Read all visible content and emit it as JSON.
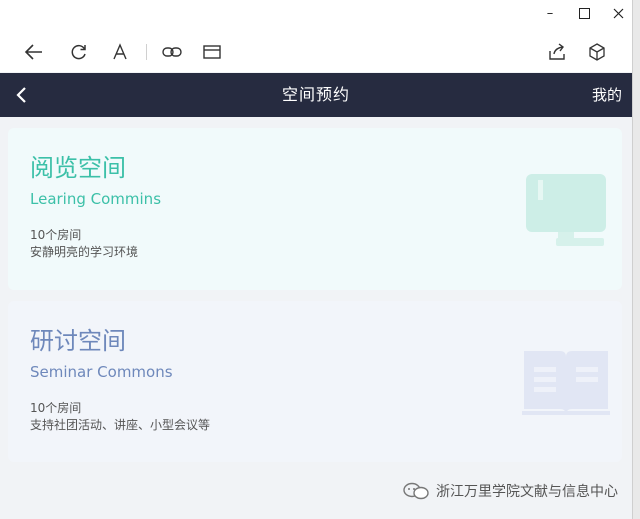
{
  "window": {
    "minimize": "–",
    "maximize": "☐",
    "close": "✕"
  },
  "toolbar": {
    "icons": [
      "back-icon",
      "refresh-icon",
      "reader-icon",
      "link-icon",
      "card-icon",
      "share-icon",
      "cube-icon"
    ]
  },
  "header": {
    "title": "空间预约",
    "right_link": "我的"
  },
  "cards": [
    {
      "title": "阅览空间",
      "subtitle": "Learing Commins",
      "count": "10个房间",
      "desc": "安静明亮的学习环境",
      "accent": "#3cc0a8"
    },
    {
      "title": "研讨空间",
      "subtitle": "Seminar Commons",
      "count": "10个房间",
      "desc": "支持社团活动、讲座、小型会议等",
      "accent": "#6e88bb"
    }
  ],
  "watermark": {
    "text": "浙江万里学院文献与信息中心"
  },
  "colors": {
    "header_bg": "#262b40",
    "page_bg": "#f1f3f6"
  }
}
